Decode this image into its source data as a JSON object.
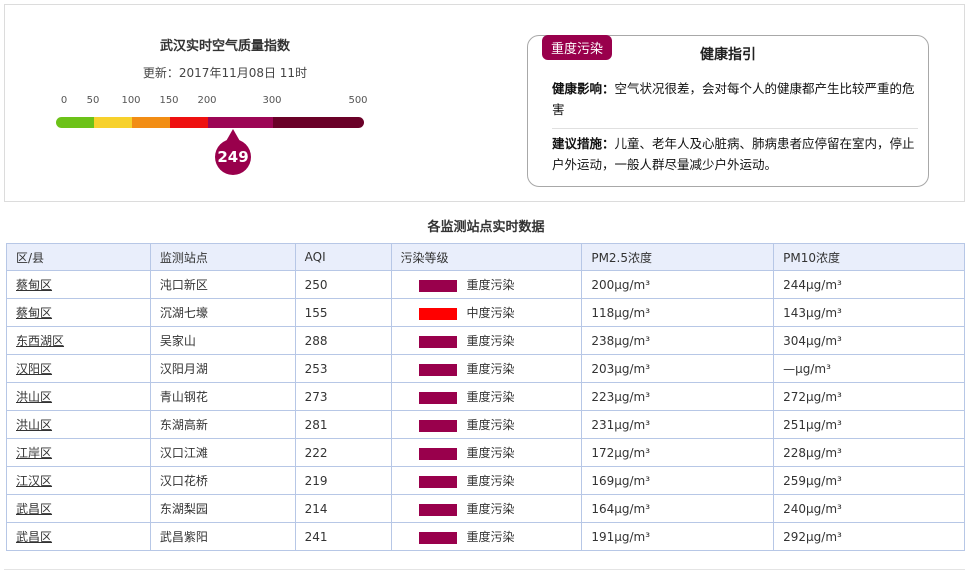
{
  "aqi_panel": {
    "title": "武汉实时空气质量指数",
    "updated": "更新：2017年11月08日 11时",
    "ticks": [
      "0",
      "50",
      "100",
      "150",
      "200",
      "300",
      "500"
    ],
    "scale_colors": [
      "#6cc218",
      "#f7d12c",
      "#f28d14",
      "#ee1010",
      "#9c0655",
      "#6a0128"
    ],
    "current_value": "249",
    "marker_color": "#99004c"
  },
  "health_guide": {
    "level_badge": "重度污染",
    "title": "健康指引",
    "impact_label": "健康影响：",
    "impact_text": "空气状况很差，会对每个人的健康都产生比较严重的危害",
    "advice_label": "建议措施：",
    "advice_text": "儿童、老年人及心脏病、肺病患者应停留在室内，停止户外运动，一般人群尽量减少户外运动。"
  },
  "stations": {
    "title": "各监测站点实时数据",
    "columns": [
      "区/县",
      "监测站点",
      "AQI",
      "污染等级",
      "PM2.5浓度",
      "PM10浓度"
    ],
    "rows": [
      {
        "district": "蔡甸区",
        "station": "沌口新区",
        "aqi": "250",
        "color": "#99004c",
        "level": "重度污染",
        "pm25": "200μg/m³",
        "pm10": "244μg/m³"
      },
      {
        "district": "蔡甸区",
        "station": "沉湖七壕",
        "aqi": "155",
        "color": "#ff0000",
        "level": "中度污染",
        "pm25": "118μg/m³",
        "pm10": "143μg/m³"
      },
      {
        "district": "东西湖区",
        "station": "吴家山",
        "aqi": "288",
        "color": "#99004c",
        "level": "重度污染",
        "pm25": "238μg/m³",
        "pm10": "304μg/m³"
      },
      {
        "district": "汉阳区",
        "station": "汉阳月湖",
        "aqi": "253",
        "color": "#99004c",
        "level": "重度污染",
        "pm25": "203μg/m³",
        "pm10": "—μg/m³"
      },
      {
        "district": "洪山区",
        "station": "青山钢花",
        "aqi": "273",
        "color": "#99004c",
        "level": "重度污染",
        "pm25": "223μg/m³",
        "pm10": "272μg/m³"
      },
      {
        "district": "洪山区",
        "station": "东湖高新",
        "aqi": "281",
        "color": "#99004c",
        "level": "重度污染",
        "pm25": "231μg/m³",
        "pm10": "251μg/m³"
      },
      {
        "district": "江岸区",
        "station": "汉口江滩",
        "aqi": "222",
        "color": "#99004c",
        "level": "重度污染",
        "pm25": "172μg/m³",
        "pm10": "228μg/m³"
      },
      {
        "district": "江汉区",
        "station": "汉口花桥",
        "aqi": "219",
        "color": "#99004c",
        "level": "重度污染",
        "pm25": "169μg/m³",
        "pm10": "259μg/m³"
      },
      {
        "district": "武昌区",
        "station": "东湖梨园",
        "aqi": "214",
        "color": "#99004c",
        "level": "重度污染",
        "pm25": "164μg/m³",
        "pm10": "240μg/m³"
      },
      {
        "district": "武昌区",
        "station": "武昌紫阳",
        "aqi": "241",
        "color": "#99004c",
        "level": "重度污染",
        "pm25": "191μg/m³",
        "pm10": "292μg/m³"
      }
    ]
  }
}
